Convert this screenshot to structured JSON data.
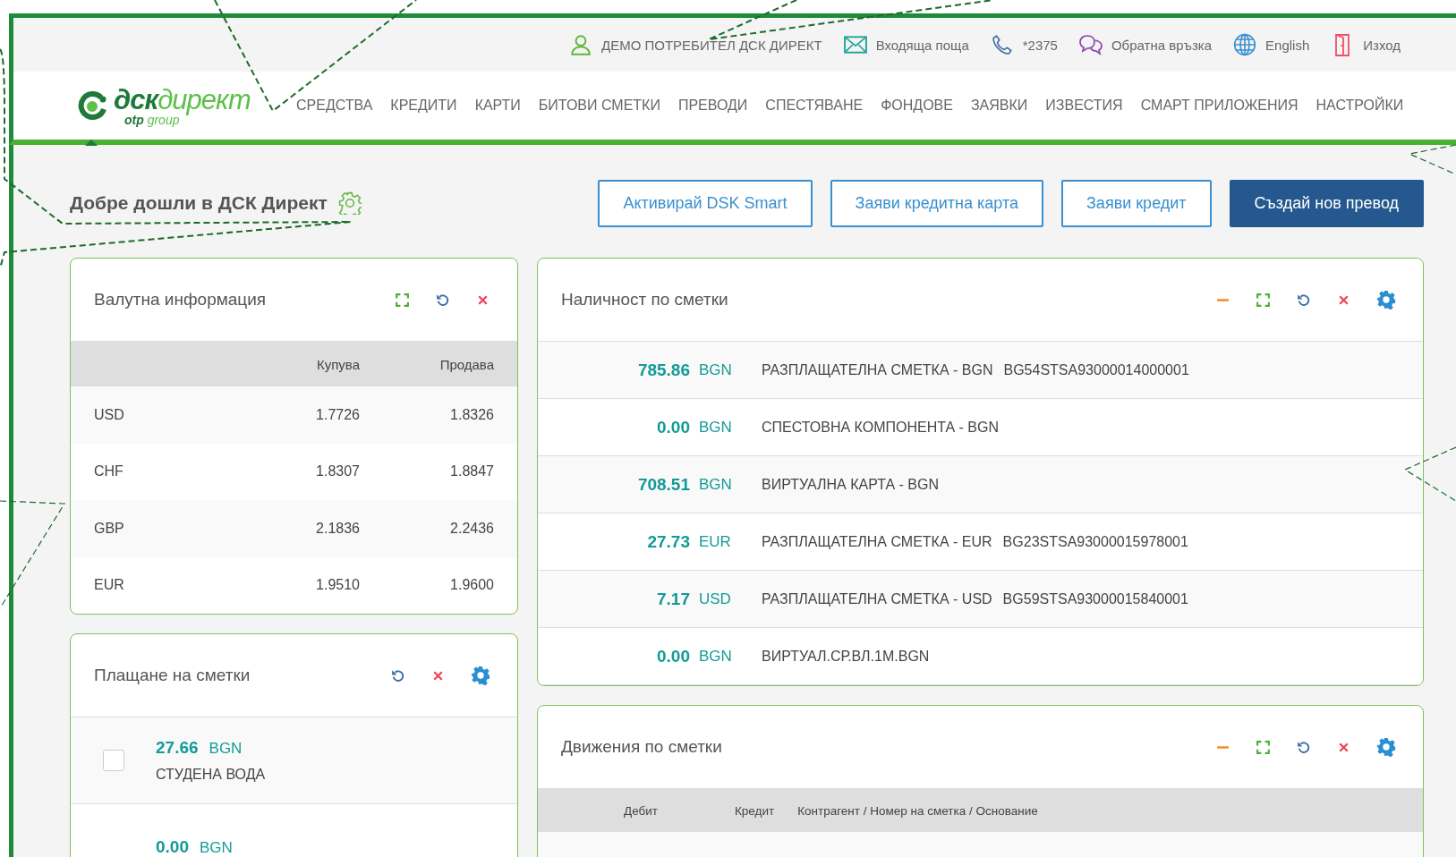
{
  "top_bar": {
    "items": [
      {
        "kind": "user",
        "label": "ДЕМО ПОТРЕБИТЕЛ ДСК ДИРЕКТ"
      },
      {
        "kind": "mail",
        "label": "Входяща поща"
      },
      {
        "kind": "phone",
        "label": "*2375"
      },
      {
        "kind": "chat",
        "label": "Обратна връзка"
      },
      {
        "kind": "globe",
        "label": "English"
      },
      {
        "kind": "exit",
        "label": "Изход"
      }
    ]
  },
  "logo": {
    "name": "дск",
    "name_light": "директ",
    "sub": "otp",
    "sub_light": "group"
  },
  "nav": [
    "СРЕДСТВА",
    "КРЕДИТИ",
    "КАРТИ",
    "БИТОВИ СМЕТКИ",
    "ПРЕВОДИ",
    "СПЕСТЯВАНЕ",
    "ФОНДОВЕ",
    "ЗАЯВКИ",
    "ИЗВЕСТИЯ",
    "СМАРТ ПРИЛОЖЕНИЯ",
    "НАСТРОЙКИ"
  ],
  "welcome": "Добре дошли в ДСК Директ",
  "actions": [
    {
      "label": "Активирай DSK Smart",
      "primary": false
    },
    {
      "label": "Заяви кредитна карта",
      "primary": false
    },
    {
      "label": "Заяви кредит",
      "primary": false
    },
    {
      "label": "Създай нов превод",
      "primary": true
    }
  ],
  "currency_card": {
    "title": "Валутна информация",
    "tools": [
      {
        "kind": "expand"
      },
      {
        "kind": "refresh"
      },
      {
        "kind": "close"
      }
    ],
    "columns": [
      "Купува",
      "Продава"
    ],
    "rows": [
      {
        "code": "USD",
        "buy": "1.7726",
        "sell": "1.8326"
      },
      {
        "code": "CHF",
        "buy": "1.8307",
        "sell": "1.8847"
      },
      {
        "code": "GBP",
        "buy": "2.1836",
        "sell": "2.2436"
      },
      {
        "code": "EUR",
        "buy": "1.9510",
        "sell": "1.9600"
      }
    ]
  },
  "bills_card": {
    "title": "Плащане на сметки",
    "tools": [
      {
        "kind": "refresh"
      },
      {
        "kind": "close"
      },
      {
        "kind": "settings"
      }
    ],
    "rows": [
      {
        "amount": "27.66",
        "currency": "BGN",
        "name": "СТУДЕНА ВОДА",
        "checked": false
      },
      {
        "amount": "0.00",
        "currency": "BGN"
      }
    ]
  },
  "accounts_card": {
    "title": "Наличност по сметки",
    "tools": [
      {
        "kind": "minimize"
      },
      {
        "kind": "expand"
      },
      {
        "kind": "refresh"
      },
      {
        "kind": "close"
      },
      {
        "kind": "settings"
      }
    ],
    "rows": [
      {
        "amount": "785.86",
        "currency": "BGN",
        "name": "РАЗПЛАЩАТЕЛНА СМЕТКА - BGN",
        "iban": "BG54STSA93000014000001"
      },
      {
        "amount": "0.00",
        "currency": "BGN",
        "name": "СПЕСТОВНА КОМПОНЕНТА - BGN"
      },
      {
        "amount": "708.51",
        "currency": "BGN",
        "name": "ВИРТУАЛНА КАРТА - BGN"
      },
      {
        "amount": "27.73",
        "currency": "EUR",
        "name": "РАЗПЛАЩАТЕЛНА СМЕТКА - EUR",
        "iban": "BG23STSA93000015978001"
      },
      {
        "amount": "7.17",
        "currency": "USD",
        "name": "РАЗПЛАЩАТЕЛНА СМЕТКА - USD",
        "iban": "BG59STSA93000015840001"
      },
      {
        "amount": "0.00",
        "currency": "BGN",
        "name": "ВИРТУАЛ.СР.ВЛ.1М.BGN"
      }
    ]
  },
  "movements_card": {
    "title": "Движения по сметки",
    "tools": [
      {
        "kind": "minimize"
      },
      {
        "kind": "expand"
      },
      {
        "kind": "refresh"
      },
      {
        "kind": "close"
      },
      {
        "kind": "settings"
      }
    ],
    "columns": [
      "Дебит",
      "Кредит",
      "Контрагент / Номер на сметка / Основание"
    ]
  }
}
